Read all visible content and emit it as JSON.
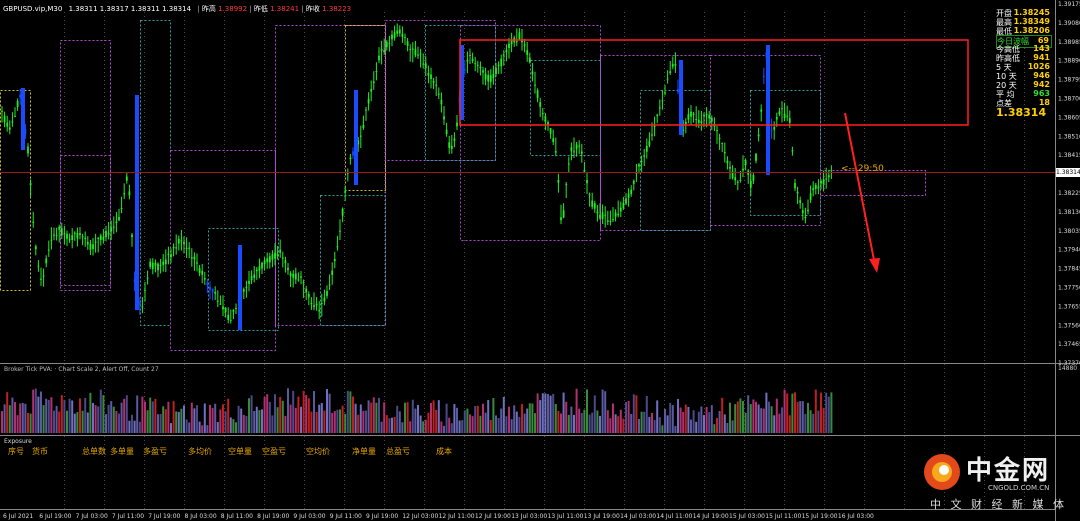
{
  "header": {
    "symbol": "GBPUSD.vip,M30",
    "ohlc": "1.38311 1.38317 1.38311 1.38314",
    "prev_close_label": "昨高",
    "prev_close": "1.38992",
    "prev_low_label": "昨低",
    "prev_low": "1.38241",
    "prev_open_label": "昨收",
    "prev_open": "1.38223"
  },
  "info_panel": {
    "rows": [
      {
        "label": "开盘",
        "value": "1.38245",
        "color": "#ffd000"
      },
      {
        "label": "最高",
        "value": "1.38349",
        "color": "#ffd000"
      },
      {
        "label": "最低",
        "value": "1.38206",
        "color": "#ffd000"
      },
      {
        "label": "今日波幅",
        "value": "69",
        "color": "#ffd000",
        "box": true
      },
      {
        "label": "今高低",
        "value": "143",
        "color": "#ffd000"
      },
      {
        "label": "昨高低",
        "value": "941",
        "color": "#ffd000"
      },
      {
        "label": "5 天",
        "value": "1026",
        "color": "#ffd000"
      },
      {
        "label": "10 天",
        "value": "946",
        "color": "#ffd000"
      },
      {
        "label": "20 天",
        "value": "942",
        "color": "#ffd000"
      },
      {
        "label": "平 均",
        "value": "963",
        "color": "#33dd33"
      },
      {
        "label": "点差",
        "value": "18",
        "color": "#ffd000"
      }
    ],
    "current_price": "1.38314"
  },
  "countdown": "<-- 29:50",
  "price_axis": {
    "labels": [
      "1.39175",
      "1.39080",
      "1.38985",
      "1.38890",
      "1.38795",
      "1.38700",
      "1.38605",
      "1.38510",
      "1.38415",
      "1.38314",
      "1.38225",
      "1.38130",
      "1.38035",
      "1.37940",
      "1.37845",
      "1.37750",
      "1.37655",
      "1.37560",
      "1.37465",
      "1.37370"
    ],
    "current_label": "1.38314"
  },
  "indicator": {
    "title": "Broker Tick PVA: · Chart Scale 2, Alert Off, Count 27",
    "axis_label": "14880"
  },
  "exposure": {
    "title": "Exposure",
    "columns": [
      "序号",
      "货币",
      "总单数",
      "多单量",
      "多盈亏",
      "多均价",
      "空单量",
      "空盈亏",
      "空均价",
      "净单量",
      "总盈亏",
      "成本"
    ]
  },
  "time_axis": {
    "labels": [
      "6 Jul 2021",
      "6 Jul 19:00",
      "7 Jul 03:00",
      "7 Jul 11:00",
      "7 Jul 19:00",
      "8 Jul 03:00",
      "8 Jul 11:00",
      "8 Jul 19:00",
      "9 Jul 03:00",
      "9 Jul 11:00",
      "9 Jul 19:00",
      "12 Jul 03:00",
      "12 Jul 11:00",
      "12 Jul 19:00",
      "13 Jul 03:00",
      "13 Jul 11:00",
      "13 Jul 19:00",
      "14 Jul 03:00",
      "14 Jul 11:00",
      "14 Jul 19:00",
      "15 Jul 03:00",
      "15 Jul 11:00",
      "15 Jul 19:00",
      "16 Jul 03:00"
    ]
  },
  "watermark": {
    "brand": "中金网",
    "domain": "CNGOLD.COM.CN",
    "slogan": "中 文 财 经 新 媒 体"
  },
  "colors": {
    "bull": "#00dd00",
    "bear": "#00dd00",
    "highlight": "#1a4cff",
    "zone": "#ff2020",
    "grid": "#3a3a3a"
  }
}
